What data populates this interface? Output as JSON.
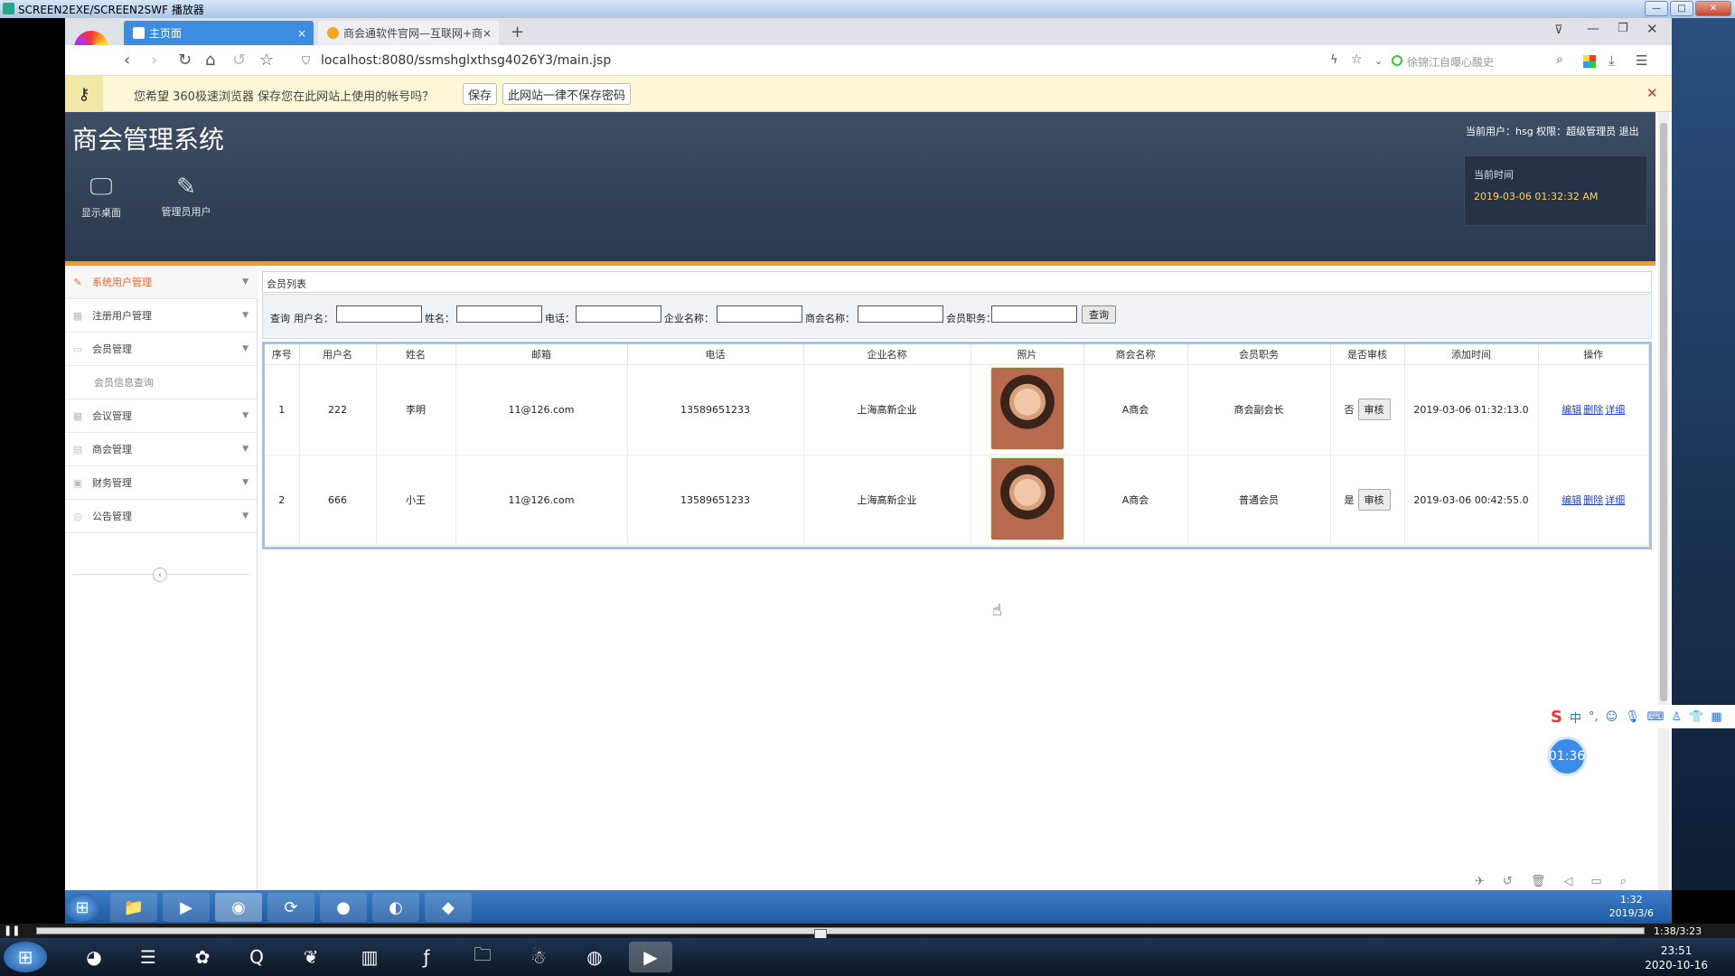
{
  "player": {
    "title": "SCREEN2EXE/SCREEN2SWF 播放器",
    "time": "1:38/3:23"
  },
  "browser": {
    "tabs": [
      {
        "label": "主页面",
        "active": true
      },
      {
        "label": "商会通软件官网—互联网+商会",
        "active": false
      }
    ],
    "url": "localhost:8080/ssmshglxthsg4026Y3/main.jsp",
    "search_hint": "徐锦江自曝心酸史",
    "password_prompt": {
      "text": "您希望 360极速浏览器 保存您在此网站上使用的帐号吗？",
      "save_label": "保存",
      "never_label": "此网站一律不保存密码"
    }
  },
  "app": {
    "title": "商会管理系统",
    "user_info": "当前用户：hsg 权限：超级管理员 退出",
    "header_nav": [
      {
        "label": "显示桌面",
        "icon": "monitor-icon"
      },
      {
        "label": "管理员用户",
        "icon": "pencil-icon"
      }
    ],
    "time_label": "当前时间",
    "time_value": "2019-03-06 01:32:32 AM",
    "sidebar": [
      {
        "label": "系统用户管理",
        "active": true
      },
      {
        "label": "注册用户管理"
      },
      {
        "label": "会员管理"
      },
      {
        "label": "会员信息查询",
        "sub": true
      },
      {
        "label": "会议管理"
      },
      {
        "label": "商会管理"
      },
      {
        "label": "财务管理"
      },
      {
        "label": "公告管理"
      }
    ],
    "panel_title": "会员列表",
    "search": {
      "prefix": "查询",
      "fields": [
        "用户名：",
        "姓名：",
        "电话：",
        "企业名称：",
        "商会名称：",
        "会员职务："
      ],
      "button": "查询"
    },
    "table": {
      "headers": [
        "序号",
        "用户名",
        "姓名",
        "邮箱",
        "电话",
        "企业名称",
        "照片",
        "商会名称",
        "会员职务",
        "是否审核",
        "添加时间",
        "操作"
      ],
      "rows": [
        {
          "no": "1",
          "username": "222",
          "name": "李明",
          "email": "11@126.com",
          "phone": "13589651233",
          "company": "上海高新企业",
          "chamber": "A商会",
          "position": "商会副会长",
          "audited": "否",
          "audit_btn": "审核",
          "added": "2019-03-06 01:32:13.0"
        },
        {
          "no": "2",
          "username": "666",
          "name": "小王",
          "email": "11@126.com",
          "phone": "13589651233",
          "company": "上海高新企业",
          "chamber": "A商会",
          "position": "普通会员",
          "audited": "是",
          "audit_btn": "审核",
          "added": "2019-03-06 00:42:55.0"
        }
      ],
      "ops": [
        "编辑",
        "删除",
        "详细"
      ]
    }
  },
  "inner_clock": {
    "time": "1:32",
    "date": "2019/3/6"
  },
  "outer_clock": {
    "time": "23:51",
    "date": "2020-10-16"
  },
  "timer_badge": "01:36",
  "ime": {
    "mode": "中"
  }
}
